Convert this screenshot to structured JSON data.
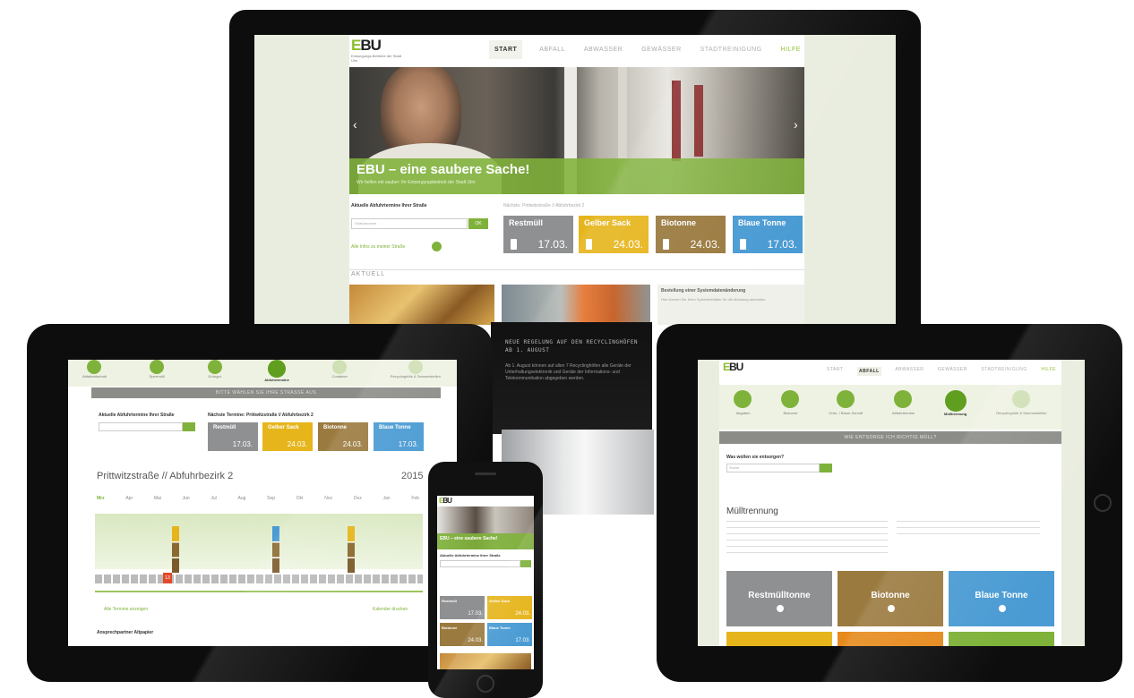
{
  "brand": {
    "logo": "EBU",
    "logo_e": "E",
    "logo_bu": "BU",
    "tagline": "Entsorgungs-Betriebe der Stadt Ulm"
  },
  "colors": {
    "green": "#7fb23a",
    "grey": "#8f9092",
    "yellow": "#e6b51c",
    "brown": "#9a7a3f",
    "blue": "#4a9bd3"
  },
  "monitor": {
    "nav": [
      "START",
      "ABFALL",
      "ABWASSER",
      "GEWÄSSER",
      "STADTREINIGUNG",
      "HILFE"
    ],
    "hero_title": "EBU – eine saubere Sache!",
    "hero_sub": "Wir helfen mit sauber: Ihr Entsorgungsbetrieb der Stadt Ulm",
    "pickup_heading": "Aktuelle Abfuhrtermine Ihrer Straße",
    "street_placeholder": "Straßenname",
    "search_btn": "OK",
    "more_link": "Alle Infos zu meiner Straße",
    "next_label": "Nächste: Prittwitzstraße // Abfuhrbezirk 2",
    "tiles": [
      {
        "name": "Restmüll",
        "date": "17.03."
      },
      {
        "name": "Gelber Sack",
        "date": "24.03."
      },
      {
        "name": "Biotonne",
        "date": "24.03."
      },
      {
        "name": "Blaue Tonne",
        "date": "17.03."
      }
    ],
    "news_heading": "AKTUELL",
    "news_title": "NEUE REGELUNG AUF DEN RECYCLINGHÖFEN AB 1. AUGUST",
    "news_body": "Ab 1. August können auf allen 7 Recyclinghöfen alle Geräte der Unterhaltungselektronik und Geräte der Informations- und Telekommunikation abgegeben werden.",
    "side_title": "Bestellung einer Systemdatenänderung",
    "side_body": "Hier können Sie Ihren Systembehälter für die Abholung anmelden."
  },
  "tablet_left": {
    "icons": [
      "Abfallwirtschaft",
      "Sperrmüll",
      "Grüngut",
      "Abfuhrtermine",
      "Container",
      "Recyclinghöfe & Sammelstellen"
    ],
    "banner": "BITTE WÄHLEN SIE IHRE STRASSE AUS",
    "street_heading": "Aktuelle Abfuhrtermine Ihrer Straße",
    "next_heading": "Nächste Termine: Prittwitzstraße // Abfuhrbezirk 2",
    "tiles": [
      {
        "name": "Restmüll",
        "date": "17.03."
      },
      {
        "name": "Gelber Sack",
        "date": "24.03."
      },
      {
        "name": "Biotonne",
        "date": "24.03."
      },
      {
        "name": "Blaue Tonne",
        "date": "17.03."
      }
    ],
    "calendar_title": "Prittwitzstraße // Abfuhrbezirk 2",
    "year": "2015",
    "months": [
      "Mrz",
      "Apr",
      "Mai",
      "Jun",
      "Jul",
      "Aug",
      "Sep",
      "Okt",
      "Nov",
      "Dez",
      "Jan",
      "Feb"
    ],
    "today": "13",
    "footer_left": "Alle Termine anzeigen",
    "footer_right": "Kalender drucken",
    "section": "Ansprechpartner Altpapier"
  },
  "phone": {
    "hero_title": "EBU – eine saubere Sache!",
    "heading": "Aktuelle Abfuhrtermine Ihrer Straße",
    "tiles": [
      {
        "name": "Restmüll",
        "date": "17.03."
      },
      {
        "name": "Gelber Sack",
        "date": "24.03."
      },
      {
        "name": "Biotonne",
        "date": "24.03."
      },
      {
        "name": "Blaue Tonne",
        "date": "17.03."
      }
    ]
  },
  "tablet_right": {
    "nav": [
      "START",
      "ABFALL",
      "ABWASSER",
      "GEWÄSSER",
      "STADTREINIGUNG",
      "HILFE"
    ],
    "icons": [
      "Abgaben",
      "Biotonne",
      "Grün- / Baum-Schnitt",
      "Abfuhrtermine",
      "Mülltrennung",
      "Recyclinghöfe & Sammelstellen"
    ],
    "banner": "WIE ENTSORGE ICH RICHTIG MÜLL?",
    "search_heading": "Was wollen sie entsorgen?",
    "search_placeholder": "Suche",
    "section_title": "Mülltrennung",
    "tiles": [
      "Restmülltonne",
      "Biotonne",
      "Blaue Tonne"
    ]
  }
}
